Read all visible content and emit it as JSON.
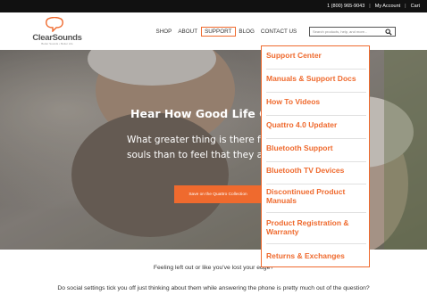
{
  "topbar": {
    "phone": "1 (800) 965-9043",
    "account": "My Account",
    "cart": "Cart"
  },
  "logo": {
    "name": "ClearSounds",
    "tagline": "Better Sounds • Better Life"
  },
  "nav": {
    "items": [
      "SHOP",
      "ABOUT",
      "SUPPORT",
      "BLOG",
      "CONTACT US"
    ],
    "active": "SUPPORT"
  },
  "search": {
    "placeholder": "Search products, help, and more..."
  },
  "hero": {
    "title": "Hear How Good Life Ca",
    "line1": "What greater thing is there for t",
    "line2": "souls than to feel that they are",
    "cta": "Save on the Quattro Collection"
  },
  "support_menu": {
    "items": [
      "Support Center",
      "Manuals & Support Docs",
      "How To Videos",
      "Quattro 4.0 Updater",
      "Bluetooth Support",
      "Bluetooth TV Devices",
      "Discontinued Product Manuals",
      "Product Registration & Warranty",
      "Returns & Exchanges"
    ]
  },
  "content": {
    "line1": "Feeling left out or like you've lost your edge?",
    "line2": "Do social settings tick you off just thinking about them while answering the phone is pretty much out of the question?"
  },
  "colors": {
    "accent": "#ef6a2e",
    "topbar": "#111111"
  }
}
